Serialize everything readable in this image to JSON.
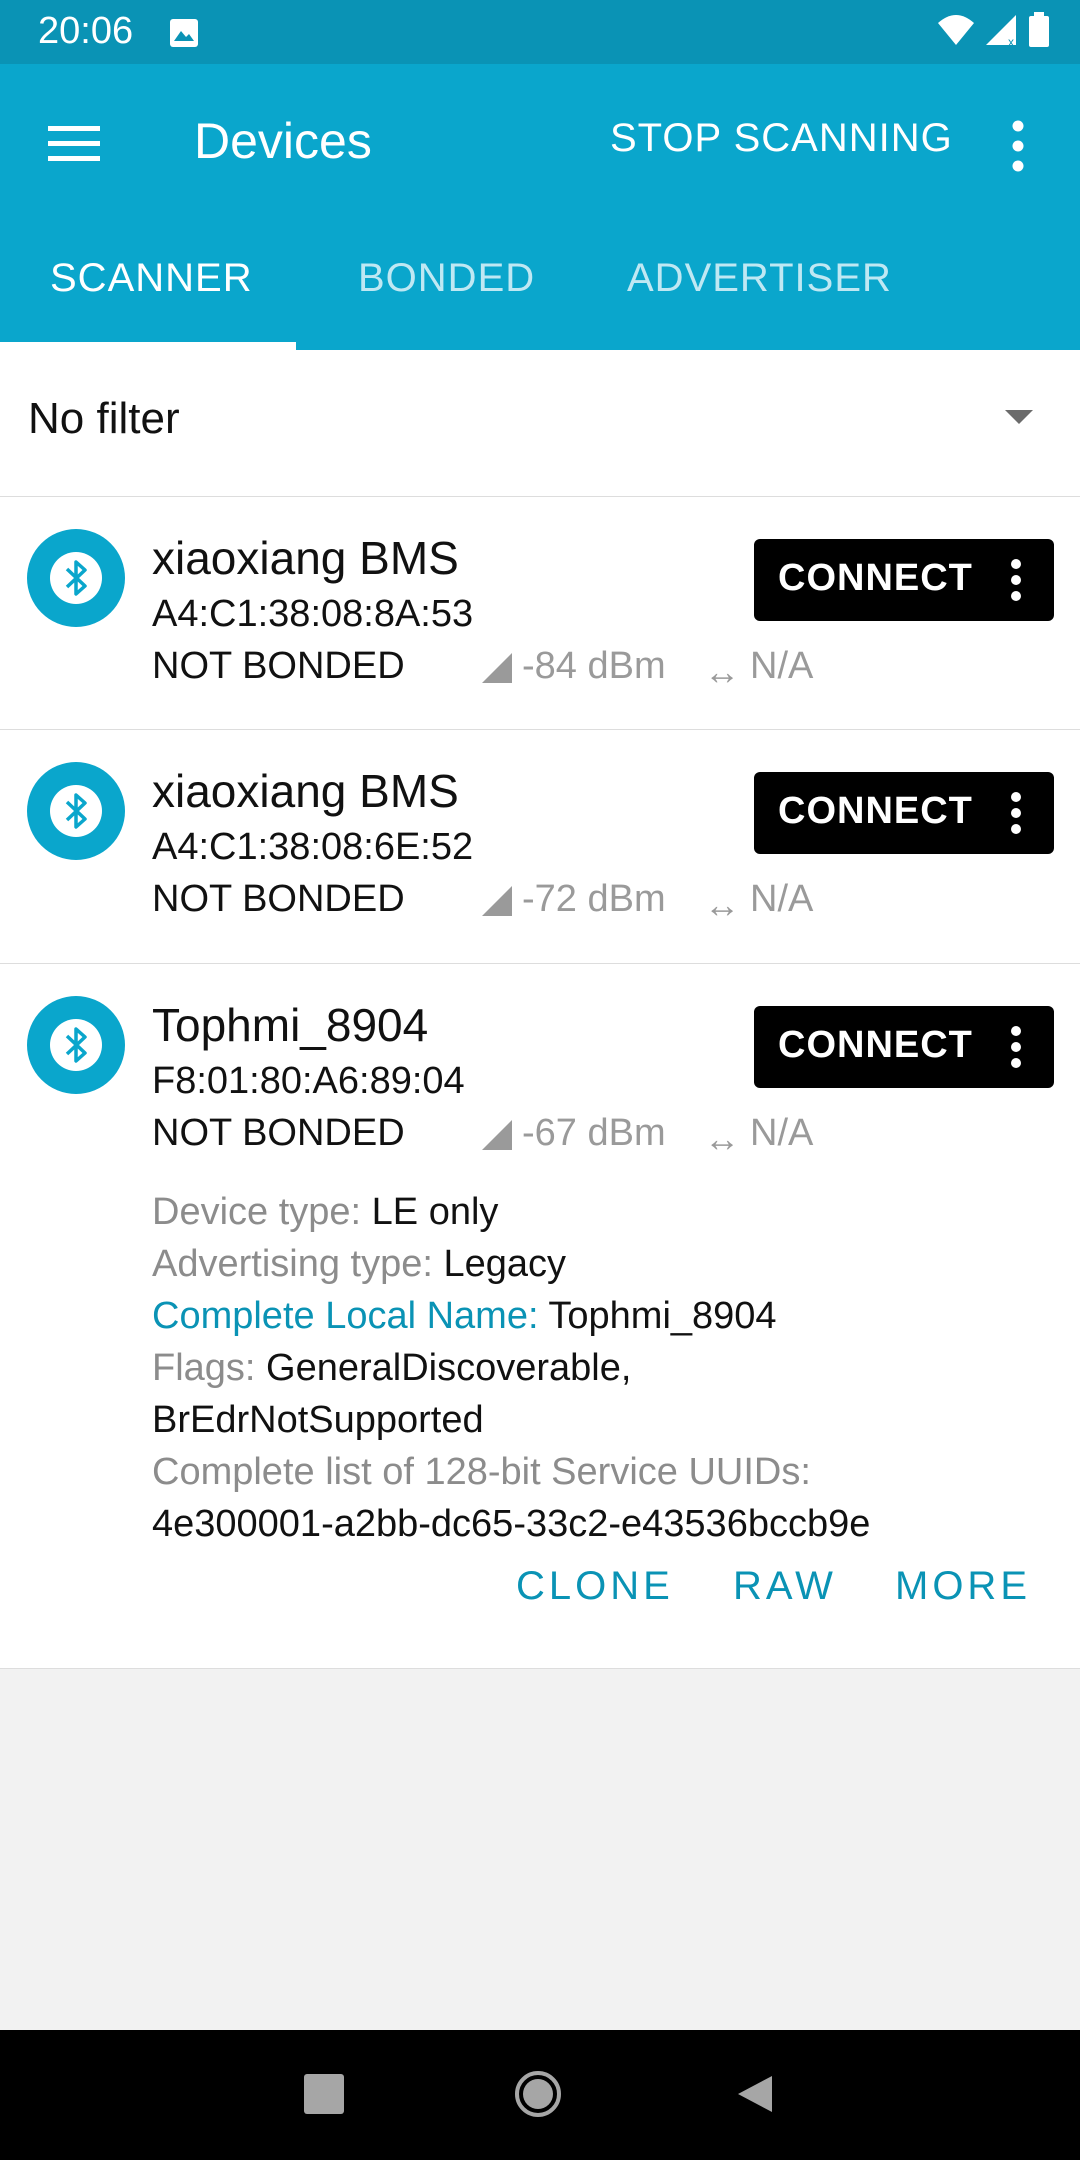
{
  "status_bar": {
    "time": "20:06"
  },
  "toolbar": {
    "title": "Devices",
    "stop_label": "STOP SCANNING"
  },
  "tabs": [
    {
      "label": "SCANNER"
    },
    {
      "label": "BONDED"
    },
    {
      "label": "ADVERTISER"
    }
  ],
  "filter": {
    "label": "No filter"
  },
  "devices": [
    {
      "name": "xiaoxiang BMS",
      "address": "A4:C1:38:08:8A:53",
      "bond": "NOT BONDED",
      "rssi": "-84 dBm",
      "interval": "N/A",
      "connect": "CONNECT"
    },
    {
      "name": "xiaoxiang BMS",
      "address": "A4:C1:38:08:6E:52",
      "bond": "NOT BONDED",
      "rssi": "-72 dBm",
      "interval": "N/A",
      "connect": "CONNECT"
    },
    {
      "name": "Tophmi_8904",
      "address": "F8:01:80:A6:89:04",
      "bond": "NOT BONDED",
      "rssi": "-67 dBm",
      "interval": "N/A",
      "connect": "CONNECT",
      "details": {
        "device_type_label": "Device type:",
        "device_type_value": "LE only",
        "adv_type_label": "Advertising type:",
        "adv_type_value": "Legacy",
        "local_name_label": "Complete Local Name:",
        "local_name_value": "Tophmi_8904",
        "flags_label": "Flags:",
        "flags_value_1": "GeneralDiscoverable,",
        "flags_value_2": "BrEdrNotSupported",
        "uuids_label": "Complete list of 128-bit Service UUIDs:",
        "uuids_value": "4e300001-a2bb-dc65-33c2-e43536bccb9e"
      },
      "actions": {
        "clone": "CLONE",
        "raw": "RAW",
        "more": "MORE"
      }
    }
  ],
  "colors": {
    "status_bar": "#0a93b5",
    "toolbar": "#0aa6cc",
    "accent_text": "#0a93b5",
    "connect_button": "#000000"
  }
}
